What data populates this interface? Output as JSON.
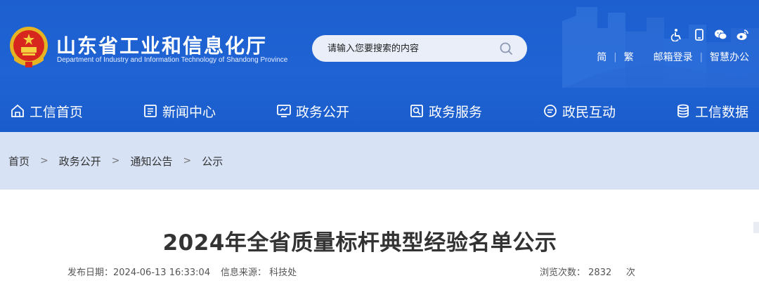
{
  "header": {
    "title_cn": "山东省工业和信息化厅",
    "title_en": "Department of Industry and Information Technology of Shandong Province",
    "emblem_icon": "national-emblem-icon",
    "colors": {
      "header_blue": "#1f63d4",
      "crumb_bg": "#d7e2f5",
      "search_bg": "#e9eef8"
    }
  },
  "search": {
    "placeholder": "请输入您要搜索的内容",
    "icon": "search-icon"
  },
  "utility": {
    "icons": [
      "accessibility-icon",
      "mobile-icon",
      "wechat-icon",
      "weibo-icon"
    ],
    "links": {
      "simplified": "简",
      "sep1": "|",
      "traditional": "繁",
      "mailbox_login": "邮箱登录",
      "sep2": "|",
      "smart_office": "智慧办公"
    }
  },
  "nav": {
    "items": [
      {
        "label": "工信首页",
        "icon": "home-icon"
      },
      {
        "label": "新闻中心",
        "icon": "news-icon"
      },
      {
        "label": "政务公开",
        "icon": "monitor-icon"
      },
      {
        "label": "政务服务",
        "icon": "service-icon"
      },
      {
        "label": "政民互动",
        "icon": "chat-icon"
      },
      {
        "label": "工信数据",
        "icon": "database-icon"
      }
    ]
  },
  "breadcrumb": {
    "items": [
      "首页",
      "政务公开",
      "通知公告",
      "公示"
    ],
    "separator": ">"
  },
  "article": {
    "title": "2024年全省质量标杆典型经验名单公示",
    "publish_label": "发布日期：",
    "publish_date": "2024-06-13 16:33:04",
    "source_label": "信息来源：",
    "source": "科技处",
    "views_label": "浏览次数：",
    "views": "2832",
    "views_unit": "次"
  }
}
